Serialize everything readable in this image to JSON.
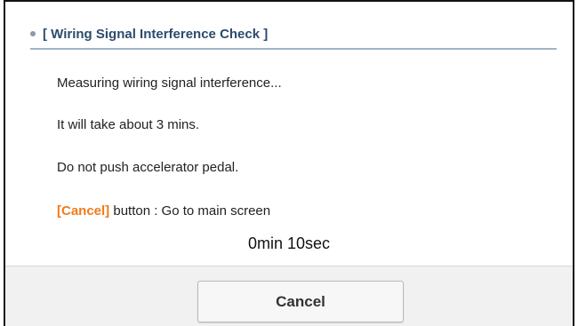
{
  "dialog": {
    "title": "[ Wiring Signal Interference Check ]",
    "messages": [
      "Measuring wiring signal interference...",
      "It will take about 3 mins.",
      "Do not push accelerator pedal."
    ],
    "cancel_hint": {
      "keyword": "[Cancel]",
      "text": " button : Go to main screen"
    },
    "timer": "0min 10sec",
    "cancel_button_label": "Cancel"
  },
  "colors": {
    "accent_orange": "#f07c1a",
    "title_blue": "#2c4b6e",
    "divider": "#9fb4c8"
  }
}
